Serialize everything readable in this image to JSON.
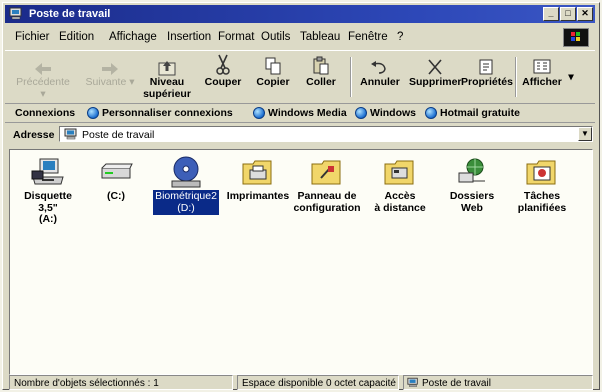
{
  "window": {
    "title": "Poste de travail"
  },
  "title_buttons": {
    "minimize": "_",
    "maximize": "□",
    "close": "✕"
  },
  "menu": [
    {
      "label": "Fichier"
    },
    {
      "label": "Edition"
    },
    {
      "label": "Affichage"
    },
    {
      "label": "Insertion"
    },
    {
      "label": "Format"
    },
    {
      "label": "Outils"
    },
    {
      "label": "Tableau"
    },
    {
      "label": "Fenêtre"
    },
    {
      "label": "?"
    }
  ],
  "toolbar": {
    "back": {
      "label": "Précédente",
      "enabled": false
    },
    "forward": {
      "label": "Suivante",
      "enabled": false
    },
    "up": {
      "label1": "Niveau",
      "label2": "supérieur"
    },
    "cut": {
      "label": "Couper"
    },
    "copy": {
      "label": "Copier"
    },
    "paste": {
      "label": "Coller"
    },
    "undo": {
      "label": "Annuler"
    },
    "delete": {
      "label": "Supprimer"
    },
    "properties": {
      "label": "Propriétés"
    },
    "view": {
      "label": "Afficher"
    }
  },
  "links": {
    "title": "Connexions",
    "items": [
      {
        "label": "Personnaliser connexions"
      },
      {
        "label": "Windows Media"
      },
      {
        "label": "Windows"
      },
      {
        "label": "Hotmail gratuite"
      }
    ]
  },
  "address": {
    "label": "Adresse",
    "value": "Poste de travail"
  },
  "items": [
    {
      "line1": "Disquette 3,5\"",
      "line2": "(A:)",
      "icon": "floppy-drive-icon"
    },
    {
      "line1": "(C:)",
      "line2": "",
      "icon": "hard-drive-icon"
    },
    {
      "line1": "Biométrique2",
      "line2": "(D:)",
      "icon": "cd-drive-icon",
      "selected": true
    },
    {
      "line1": "Imprimantes",
      "line2": "",
      "icon": "printer-folder-icon"
    },
    {
      "line1": "Panneau de",
      "line2": "configuration",
      "icon": "control-panel-icon"
    },
    {
      "line1": "Accès",
      "line2": "à distance",
      "icon": "dial-up-icon"
    },
    {
      "line1": "Dossiers",
      "line2": "Web",
      "icon": "web-folders-icon"
    },
    {
      "line1": "Tâches",
      "line2": "planifiées",
      "icon": "scheduled-tasks-icon"
    }
  ],
  "status": {
    "selected": "Nombre d'objets sélectionnés : 1",
    "space": "Espace disponible 0 octet capacité",
    "location": "Poste de travail"
  }
}
